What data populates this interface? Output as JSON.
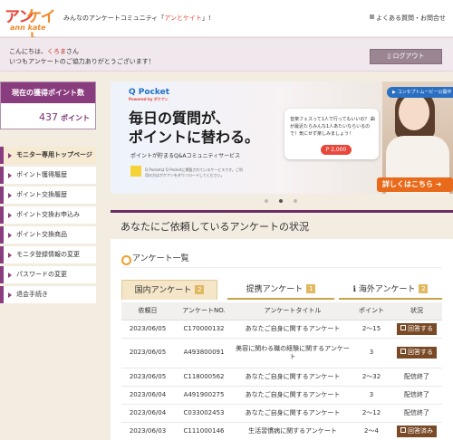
{
  "header": {
    "logo": {
      "part1": "アン",
      "part2": "ケイト",
      "sub": "ann kate"
    },
    "tagline_pre": "みんなのアンケートコミュニティ「",
    "tagline_highlight": "アンとケイト",
    "tagline_post": "」!",
    "faq_label": "よくある質問・お問合せ"
  },
  "welcome": {
    "greeting_pre": "こんにちは、",
    "user_name": "くろま",
    "greeting_post": "さん",
    "thanks": "いつもアンケートのご協力ありがとうございます！",
    "logout_label": "ログアウト"
  },
  "points": {
    "label": "現在の獲得ポイント数",
    "value": "437",
    "unit": "ポイント"
  },
  "sidebar": {
    "items": [
      {
        "label": "モニター専用トップページ"
      },
      {
        "label": "ポイント獲得履歴"
      },
      {
        "label": "ポイント交換履歴"
      },
      {
        "label": "ポイント交換お申込み"
      },
      {
        "label": "ポイント交換商品"
      },
      {
        "label": "モニタ登録情報の変更"
      },
      {
        "label": "パスワードの変更"
      },
      {
        "label": "退会手続き"
      }
    ]
  },
  "banner": {
    "brand": "Q Pocket",
    "brand_sub": "Powered by ポケアン",
    "headline1": "毎日の質問が、",
    "headline2": "ポイントに替わる。",
    "subtext": "ポイントが貯まるQ&Aコミュニティサービス",
    "note": "Q Pocketは Q Pocketに掲載されているサービスです。ご利用の方はポケアンをダウンロードしてください。",
    "card_text": "音楽フェスって1人で行ってもいいの？ 曲が最近たらみんな1人あたいならいるので！気にせず楽しみましょう！",
    "card_points": "2,000",
    "movie_label": "コンセプトムービー公開中",
    "cta": "詳しくはこちら"
  },
  "main": {
    "section_title": "あなたにご依頼しているアンケートの状況",
    "panel_title": "アンケート一覧",
    "tabs": [
      {
        "label": "国内アンケート",
        "count": "2"
      },
      {
        "label": "提携アンケート",
        "count": "1"
      },
      {
        "label": "海外アンケート",
        "count": "2"
      }
    ],
    "table": {
      "headers": [
        "依頼日",
        "アンケートNO.",
        "アンケートタイトル",
        "ポイント",
        "状況"
      ],
      "rows": [
        {
          "date": "2023/06/05",
          "no": "C170000132",
          "title": "あなたご自身に関するアンケート",
          "points": "2〜15",
          "status": "回答する",
          "type": "button"
        },
        {
          "date": "2023/06/05",
          "no": "A493800091",
          "title": "美容に関わる職の経験に関するアンケート",
          "points": "3",
          "status": "回答する",
          "type": "button"
        },
        {
          "date": "2023/06/05",
          "no": "C118000562",
          "title": "あなたご自身に関するアンケート",
          "points": "2〜32",
          "status": "配信終了",
          "type": "text"
        },
        {
          "date": "2023/06/04",
          "no": "A491900275",
          "title": "あなたご自身に関するアンケート",
          "points": "3",
          "status": "配信終了",
          "type": "text"
        },
        {
          "date": "2023/06/04",
          "no": "C033002453",
          "title": "あなたご自身に関するアンケート",
          "points": "2〜12",
          "status": "配信終了",
          "type": "text"
        },
        {
          "date": "2023/06/03",
          "no": "C111000146",
          "title": "生活習慣病に関するアンケート",
          "points": "2〜4",
          "status": "回答済み",
          "type": "button"
        }
      ]
    }
  },
  "carousel": {
    "count": 3,
    "active": 1
  }
}
